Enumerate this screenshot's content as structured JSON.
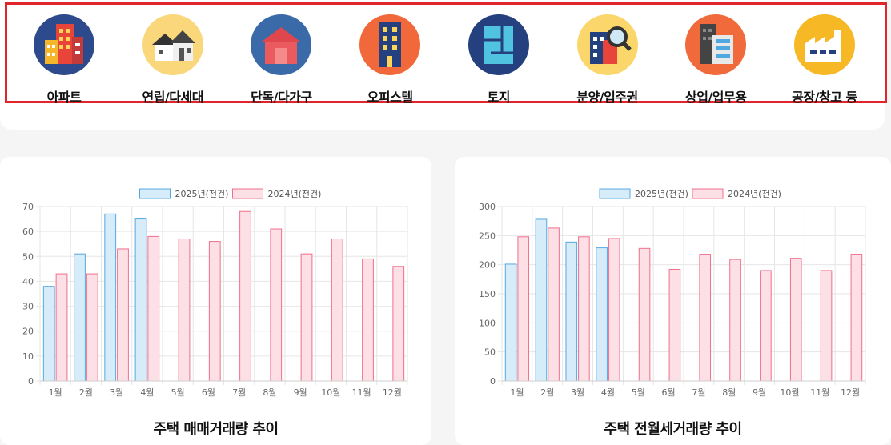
{
  "categories_nav": [
    {
      "label": "아파트",
      "icon": "apartment-building-icon",
      "bg": "#2c4a8c"
    },
    {
      "label": "연립/다세대",
      "icon": "row-house-icon",
      "bg": "#f9d77a"
    },
    {
      "label": "단독/다가구",
      "icon": "detached-house-icon",
      "bg": "#3a6aa8"
    },
    {
      "label": "오피스텔",
      "icon": "officetel-icon",
      "bg": "#f1693a"
    },
    {
      "label": "토지",
      "icon": "land-plot-icon",
      "bg": "#24407e"
    },
    {
      "label": "분양/입주권",
      "icon": "presale-search-icon",
      "bg": "#fbd76b"
    },
    {
      "label": "상업/업무용",
      "icon": "commercial-building-icon",
      "bg": "#f06a3c"
    },
    {
      "label": "공장/창고 등",
      "icon": "factory-icon",
      "bg": "#f6b824"
    }
  ],
  "colors": {
    "series2025_fill": "#d7ecf9",
    "series2025_stroke": "#55a8e0",
    "series2024_fill": "#fde0e6",
    "series2024_stroke": "#ef6f8c",
    "grid": "#e6e6e6",
    "nav_border": "#e0262b"
  },
  "chart_data": [
    {
      "type": "bar",
      "title": "주택 매매거래량 추이",
      "categories": [
        "1월",
        "2월",
        "3월",
        "4월",
        "5월",
        "6월",
        "7월",
        "8월",
        "9월",
        "10월",
        "11월",
        "12월"
      ],
      "series": [
        {
          "name": "2025년(천건)",
          "values": [
            38,
            51,
            67,
            65,
            null,
            null,
            null,
            null,
            null,
            null,
            null,
            null
          ]
        },
        {
          "name": "2024년(천건)",
          "values": [
            43,
            43,
            53,
            58,
            57,
            56,
            68,
            61,
            51,
            57,
            49,
            46
          ]
        }
      ],
      "ylim": [
        0,
        70
      ],
      "yticks": [
        0,
        10,
        20,
        30,
        40,
        50,
        60,
        70
      ],
      "grid": true,
      "legend": "top-center"
    },
    {
      "type": "bar",
      "title": "주택 전월세거래량 추이",
      "categories": [
        "1월",
        "2월",
        "3월",
        "4월",
        "5월",
        "6월",
        "7월",
        "8월",
        "9월",
        "10월",
        "11월",
        "12월"
      ],
      "series": [
        {
          "name": "2025년(천건)",
          "values": [
            201,
            278,
            239,
            229,
            null,
            null,
            null,
            null,
            null,
            null,
            null,
            null
          ]
        },
        {
          "name": "2024년(천건)",
          "values": [
            248,
            263,
            248,
            245,
            228,
            192,
            218,
            209,
            190,
            211,
            190,
            218
          ]
        }
      ],
      "ylim": [
        0,
        300
      ],
      "yticks": [
        0,
        50,
        100,
        150,
        200,
        250,
        300
      ],
      "grid": true,
      "legend": "top-center"
    }
  ]
}
